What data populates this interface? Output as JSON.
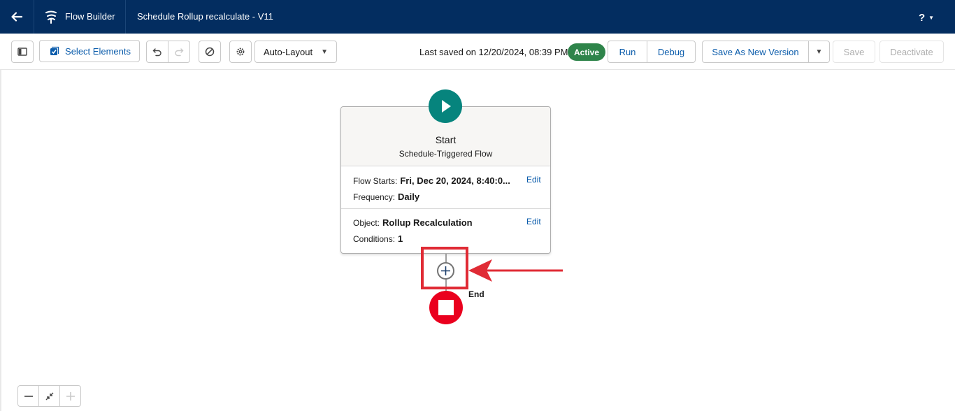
{
  "header": {
    "app_name": "Flow Builder",
    "flow_title": "Schedule Rollup recalculate - V11",
    "help_label": "?",
    "icons": {
      "back": "arrow-left-icon",
      "app": "flow-icon",
      "help_caret": "chevron-down-icon"
    }
  },
  "toolbar": {
    "select_elements_label": "Select Elements",
    "layout_select_value": "Auto-Layout",
    "last_saved_text": "Last saved on 12/20/2024, 08:39 PM",
    "status_badge": "Active",
    "run_label": "Run",
    "debug_label": "Debug",
    "save_as_new_version_label": "Save As New Version",
    "save_label": "Save",
    "deactivate_label": "Deactivate",
    "icons": [
      "toggle-panel-icon",
      "checkbox-icon",
      "undo-icon",
      "redo-icon",
      "ban-icon",
      "gear-icon",
      "chevron-down-icon"
    ]
  },
  "start_element": {
    "title": "Start",
    "subtitle": "Schedule-Triggered Flow",
    "flow_starts_label": "Flow Starts:",
    "flow_starts_value": "Fri, Dec 20, 2024, 8:40:0...",
    "frequency_label": "Frequency:",
    "frequency_value": "Daily",
    "object_label": "Object:",
    "object_value": "Rollup Recalculation",
    "conditions_label": "Conditions:",
    "conditions_value": "1",
    "edit_label": "Edit"
  },
  "end_element": {
    "label": "End"
  },
  "colors": {
    "header_bg": "#032d60",
    "brand_blue": "#0b5cab",
    "active_green": "#2e844a",
    "start_teal": "#06847d",
    "end_red": "#ea001e",
    "highlight_red": "#e02b35"
  }
}
